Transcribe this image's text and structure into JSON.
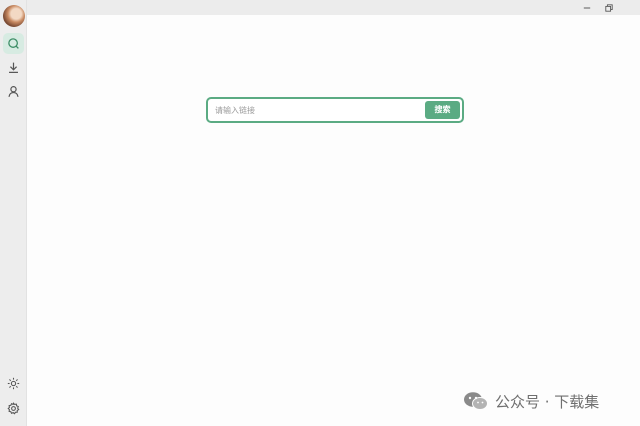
{
  "sidebar": {
    "items": [
      {
        "name": "search",
        "icon": "search-icon",
        "active": true
      },
      {
        "name": "downloads",
        "icon": "download-icon",
        "active": false
      },
      {
        "name": "profile",
        "icon": "user-icon",
        "active": false
      }
    ],
    "bottom_items": [
      {
        "name": "theme",
        "icon": "sun-icon"
      },
      {
        "name": "settings",
        "icon": "gear-icon"
      }
    ]
  },
  "window_controls": {
    "minimize_icon": "minimize-icon",
    "restore_icon": "restore-icon"
  },
  "search": {
    "placeholder": "请输入链接",
    "value": "",
    "button_label": "搜索"
  },
  "watermark": {
    "icon": "wechat-icon",
    "text": "公众号 · 下载集"
  },
  "colors": {
    "accent": "#5bab83",
    "accent_light": "#d7ebe2",
    "sidebar_bg": "#ededed",
    "page_bg": "#fdfdfd"
  }
}
